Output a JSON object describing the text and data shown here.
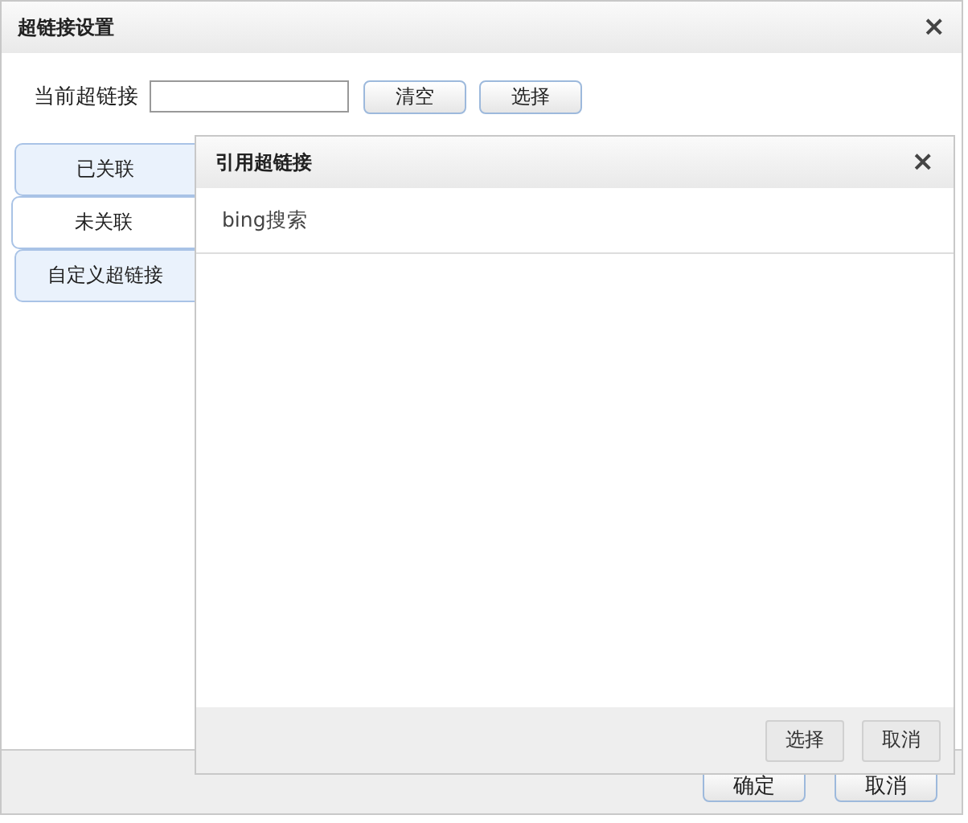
{
  "window": {
    "title": "超链接设置",
    "close": "×"
  },
  "current_link": {
    "label": "当前超链接",
    "buttons": [
      "清空",
      "选择"
    ]
  },
  "tabs": [
    {
      "label": "已关联",
      "selected": false
    },
    {
      "label": "未关联",
      "selected": true
    },
    {
      "label": "自定义超链接",
      "selected": false
    }
  ],
  "footer_buttons": [
    "确定",
    "取消"
  ],
  "popup": {
    "title": "引用超链接",
    "close": "×",
    "items": [
      {
        "label": "bing搜索",
        "selected": false
      }
    ],
    "buttons": [
      "选择",
      "取消"
    ]
  }
}
